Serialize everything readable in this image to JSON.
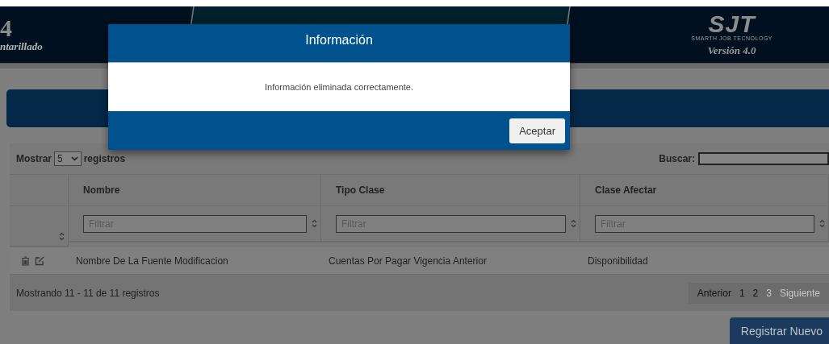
{
  "header": {
    "title_fragment": "4",
    "subtitle_fragment": "ntarillado",
    "logo": "SJT",
    "logo_tagline": "SMARTH JOB TECNOLOGY",
    "version": "Versión 4.0"
  },
  "table": {
    "length_label": "Mostrar",
    "length_value": "5",
    "length_suffix": "registros",
    "search_label": "Buscar:",
    "columns": [
      "Nombre",
      "Tipo Clase",
      "Clase Afectar"
    ],
    "filter_placeholders": [
      "Filtrar",
      "Filtrar",
      "Filtrar"
    ],
    "rows": [
      {
        "cells": [
          "Nombre De La Fuente Modificacion",
          "Cuentas Por Pagar Vigencia Anterior",
          "Disponibilidad"
        ]
      }
    ],
    "info": "Mostrando 11 - 11 de 11 registros",
    "pagination": [
      {
        "label": "Anterior",
        "disabled": false
      },
      {
        "label": "1",
        "disabled": false
      },
      {
        "label": "2",
        "disabled": false
      },
      {
        "label": "3",
        "disabled": true
      },
      {
        "label": "Siguiente",
        "disabled": true
      }
    ]
  },
  "new_button": "Registrar Nuevo",
  "dialog": {
    "title": "Información",
    "message": "Información eliminada correctamente.",
    "button": "Aceptar"
  }
}
